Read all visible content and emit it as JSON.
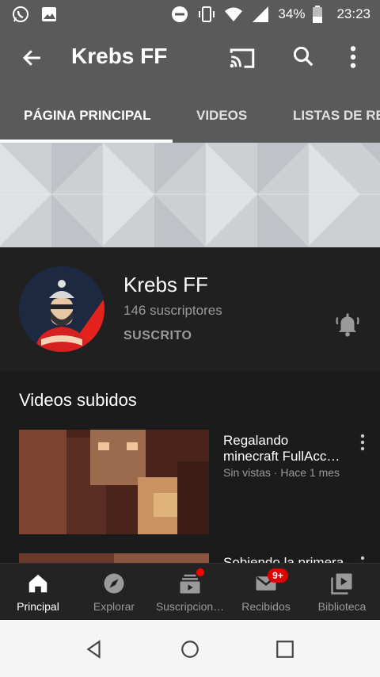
{
  "status_bar": {
    "battery": "34%",
    "time": "23:23",
    "icons": [
      "whatsapp-icon",
      "image-icon",
      "dnd-icon",
      "vibrate-icon",
      "wifi-icon",
      "signal-icon",
      "battery-icon"
    ]
  },
  "app_bar": {
    "title": "Krebs FF",
    "icons": [
      "back-arrow-icon",
      "cast-icon",
      "search-icon",
      "more-vert-icon"
    ]
  },
  "tabs": [
    {
      "label": "PÁGINA PRINCIPAL",
      "active": true
    },
    {
      "label": "VIDEOS",
      "active": false
    },
    {
      "label": "LISTAS DE RE",
      "active": false
    }
  ],
  "channel": {
    "name": "Krebs FF",
    "subscribers": "146 suscriptores",
    "subscribe_state": "SUSCRITO"
  },
  "uploads": {
    "title": "Videos subidos",
    "videos": [
      {
        "title_line1": "Regalando",
        "title_line2": "minecraft FullAcc…",
        "meta": "Sin vistas · Hace 1 mes"
      },
      {
        "title_line1": "Sobiendo la primera",
        "title_line2": "",
        "meta": ""
      }
    ]
  },
  "bottom_nav": [
    {
      "label": "Principal",
      "icon": "home-icon",
      "active": true
    },
    {
      "label": "Explorar",
      "icon": "compass-icon",
      "active": false
    },
    {
      "label": "Suscripcion…",
      "icon": "subscriptions-icon",
      "active": false
    },
    {
      "label": "Recibidos",
      "icon": "inbox-icon",
      "active": false,
      "badge": "9+"
    },
    {
      "label": "Biblioteca",
      "icon": "library-icon",
      "active": false
    }
  ],
  "colors": {
    "app_bar": "#5a5a5a",
    "background": "#1b1b1b",
    "accent_red": "#ff0000",
    "secondary_text": "#9a9a9a"
  }
}
